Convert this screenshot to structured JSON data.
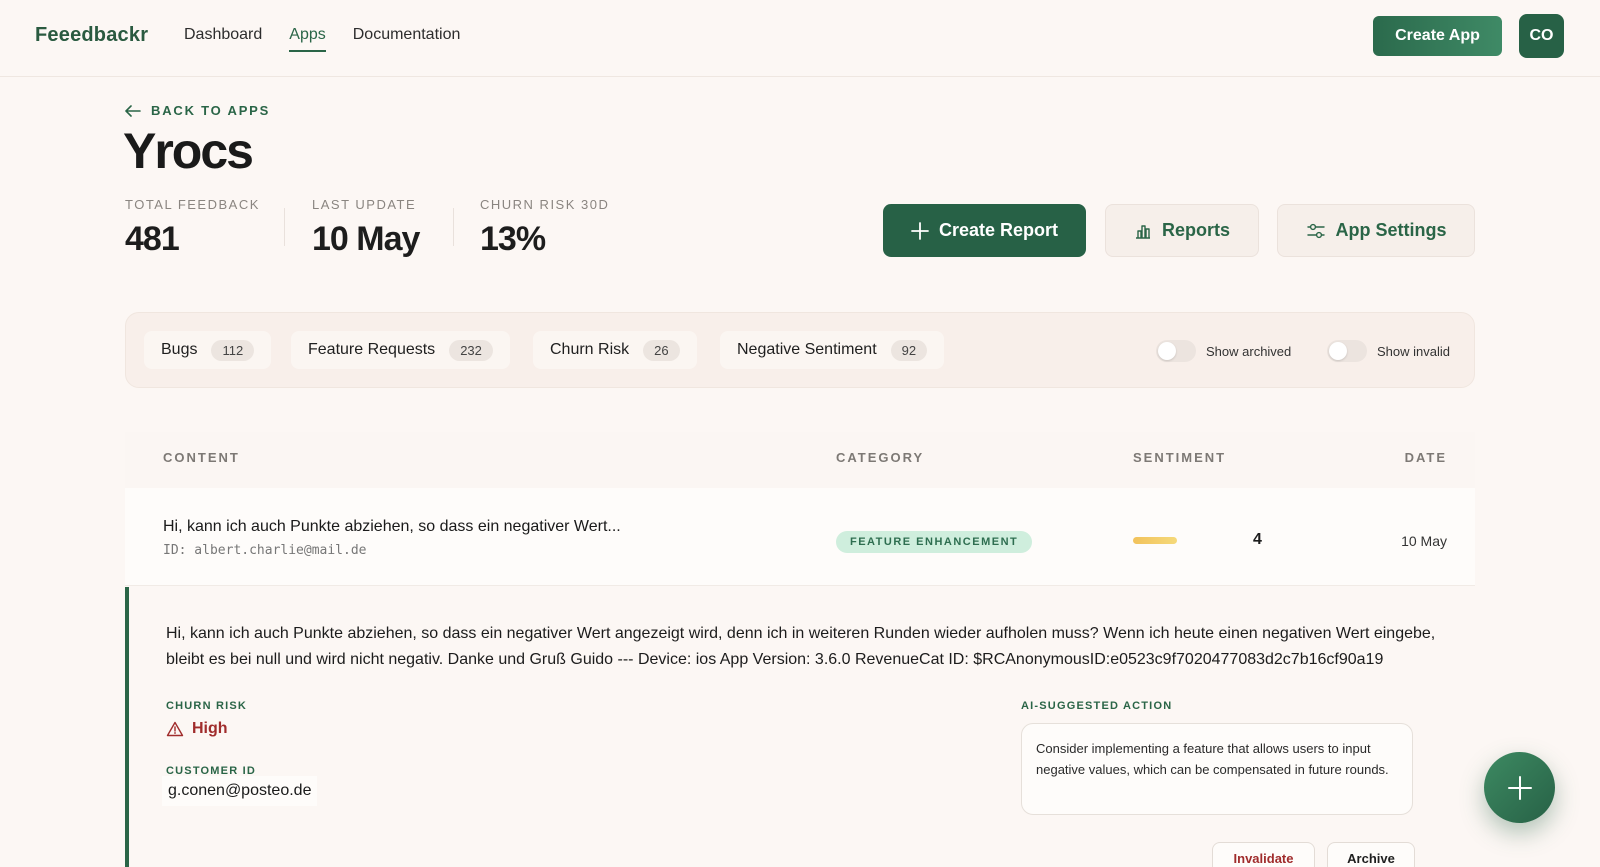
{
  "header": {
    "logo": "Feeedbackr",
    "nav": [
      {
        "label": "Dashboard",
        "active": false
      },
      {
        "label": "Apps",
        "active": true
      },
      {
        "label": "Documentation",
        "active": false
      }
    ],
    "create_app_label": "Create App",
    "avatar_initials": "CO"
  },
  "page": {
    "back_label": "BACK TO APPS",
    "title": "Yrocs",
    "stats": [
      {
        "label": "TOTAL FEEDBACK",
        "value": "481"
      },
      {
        "label": "LAST UPDATE",
        "value": "10 May"
      },
      {
        "label": "CHURN RISK 30D",
        "value": "13%"
      }
    ],
    "actions": {
      "create_report": "Create Report",
      "reports": "Reports",
      "app_settings": "App Settings"
    }
  },
  "filters": {
    "chips": [
      {
        "label": "Bugs",
        "count": "112"
      },
      {
        "label": "Feature Requests",
        "count": "232"
      },
      {
        "label": "Churn Risk",
        "count": "26"
      },
      {
        "label": "Negative Sentiment",
        "count": "92"
      }
    ],
    "toggles": [
      {
        "label": "Show archived",
        "on": false
      },
      {
        "label": "Show invalid",
        "on": false
      }
    ]
  },
  "table": {
    "headers": {
      "content": "CONTENT",
      "category": "CATEGORY",
      "sentiment": "SENTIMENT",
      "date": "DATE"
    },
    "rows": [
      {
        "content": "Hi, kann ich auch Punkte abziehen, so dass ein negativer Wert...",
        "id_line": "ID: albert.charlie@mail.de",
        "category": "FEATURE ENHANCEMENT",
        "sentiment_score": "4",
        "date": "10 May"
      }
    ]
  },
  "detail": {
    "full_text": "Hi, kann ich auch Punkte abziehen, so dass ein negativer Wert angezeigt wird, denn ich in weiteren Runden wieder aufholen muss? Wenn ich heute einen negativen Wert eingebe, bleibt es bei null und wird nicht negativ. Danke und Gruß Guido --- Device: ios App Version: 3.6.0 RevenueCat ID: $RCAnonymousID:e0523c9f7020477083d2c7b16cf90a19",
    "churn_risk_label": "CHURN RISK",
    "churn_risk_value": "High",
    "customer_id_label": "CUSTOMER ID",
    "customer_id_value": "g.conen@posteo.de",
    "ai_label": "AI-SUGGESTED ACTION",
    "ai_text": "Consider implementing a feature that allows users to input negative values, which can be compensated in future rounds.",
    "invalidate_label": "Invalidate",
    "archive_label": "Archive"
  },
  "colors": {
    "brand": "#276146",
    "background": "#fcf7f4",
    "danger": "#a02c2c",
    "badge_bg": "#cfeedd"
  },
  "icons": [
    "arrow-left-icon",
    "plus-icon",
    "bar-chart-icon",
    "sliders-icon",
    "warning-triangle-icon"
  ]
}
